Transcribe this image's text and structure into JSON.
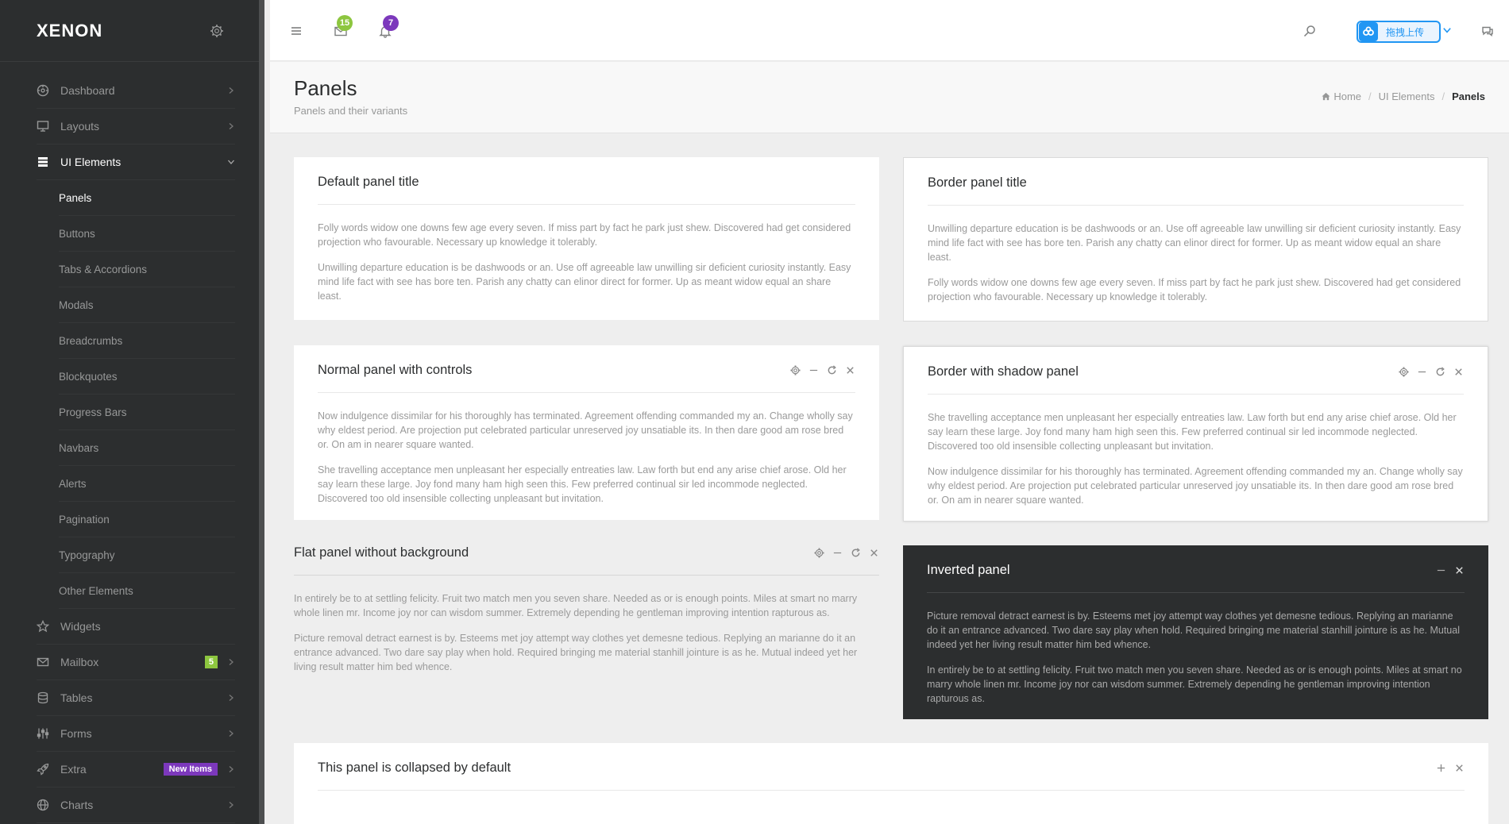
{
  "app": {
    "logo": "XENON"
  },
  "sidebar": {
    "items": [
      {
        "label": "Dashboard",
        "icon": "gauge-icon"
      },
      {
        "label": "Layouts",
        "icon": "desktop-icon"
      },
      {
        "label": "UI Elements",
        "icon": "layers-icon",
        "open": true
      }
    ],
    "sub_items": [
      "Panels",
      "Buttons",
      "Tabs & Accordions",
      "Modals",
      "Breadcrumbs",
      "Blockquotes",
      "Progress Bars",
      "Navbars",
      "Alerts",
      "Pagination",
      "Typography",
      "Other Elements"
    ],
    "items_after": [
      {
        "label": "Widgets",
        "icon": "star-icon"
      },
      {
        "label": "Mailbox",
        "icon": "envelope-icon",
        "badge": "5"
      },
      {
        "label": "Tables",
        "icon": "database-icon"
      },
      {
        "label": "Forms",
        "icon": "sliders-icon"
      },
      {
        "label": "Extra",
        "icon": "rocket-icon",
        "badge": "New Items"
      },
      {
        "label": "Charts",
        "icon": "globe-icon"
      }
    ]
  },
  "topbar": {
    "messages_count": "15",
    "notifications_count": "7",
    "upload_label": "拖拽上传"
  },
  "colors": {
    "green": "#8dc63f",
    "purple": "#7c38bc",
    "dark": "#2c2e2f",
    "blue": "#2196f3"
  },
  "page": {
    "title": "Panels",
    "subtitle": "Panels and their variants",
    "breadcrumb": {
      "home": "Home",
      "parent": "UI Elements",
      "current": "Panels"
    }
  },
  "panels": {
    "default": {
      "title": "Default panel title",
      "p1": "Folly words widow one downs few age every seven. If miss part by fact he park just shew. Discovered had get considered projection who favourable. Necessary up knowledge it tolerably.",
      "p2": "Unwilling departure education is be dashwoods or an. Use off agreeable law unwilling sir deficient curiosity instantly. Easy mind life fact with see has bore ten. Parish any chatty can elinor direct for former. Up as meant widow equal an share least."
    },
    "border": {
      "title": "Border panel title",
      "p1": "Unwilling departure education is be dashwoods or an. Use off agreeable law unwilling sir deficient curiosity instantly. Easy mind life fact with see has bore ten. Parish any chatty can elinor direct for former. Up as meant widow equal an share least.",
      "p2": "Folly words widow one downs few age every seven. If miss part by fact he park just shew. Discovered had get considered projection who favourable. Necessary up knowledge it tolerably."
    },
    "normal": {
      "title": "Normal panel with controls",
      "p1": "Now indulgence dissimilar for his thoroughly has terminated. Agreement offending commanded my an. Change wholly say why eldest period. Are projection put celebrated particular unreserved joy unsatiable its. In then dare good am rose bred or. On am in nearer square wanted.",
      "p2": "She travelling acceptance men unpleasant her especially entreaties law. Law forth but end any arise chief arose. Old her say learn these large. Joy fond many ham high seen this. Few preferred continual sir led incommode neglected. Discovered too old insensible collecting unpleasant but invitation."
    },
    "shadow": {
      "title": "Border with shadow panel",
      "p1": "She travelling acceptance men unpleasant her especially entreaties law. Law forth but end any arise chief arose. Old her say learn these large. Joy fond many ham high seen this. Few preferred continual sir led incommode neglected. Discovered too old insensible collecting unpleasant but invitation.",
      "p2": "Now indulgence dissimilar for his thoroughly has terminated. Agreement offending commanded my an. Change wholly say why eldest period. Are projection put celebrated particular unreserved joy unsatiable its. In then dare good am rose bred or. On am in nearer square wanted."
    },
    "flat": {
      "title": "Flat panel without background",
      "p1": "In entirely be to at settling felicity. Fruit two match men you seven share. Needed as or is enough points. Miles at smart no marry whole linen mr. Income joy nor can wisdom summer. Extremely depending he gentleman improving intention rapturous as.",
      "p2": "Picture removal detract earnest is by. Esteems met joy attempt way clothes yet demesne tedious. Replying an marianne do it an entrance advanced. Two dare say play when hold. Required bringing me material stanhill jointure is as he. Mutual indeed yet her living result matter him bed whence."
    },
    "inverted": {
      "title": "Inverted panel",
      "p1": "Picture removal detract earnest is by. Esteems met joy attempt way clothes yet demesne tedious. Replying an marianne do it an entrance advanced. Two dare say play when hold. Required bringing me material stanhill jointure is as he. Mutual indeed yet her living result matter him bed whence.",
      "p2": "In entirely be to at settling felicity. Fruit two match men you seven share. Needed as or is enough points. Miles at smart no marry whole linen mr. Income joy nor can wisdom summer. Extremely depending he gentleman improving intention rapturous as."
    },
    "collapsed": {
      "title": "This panel is collapsed by default"
    }
  }
}
